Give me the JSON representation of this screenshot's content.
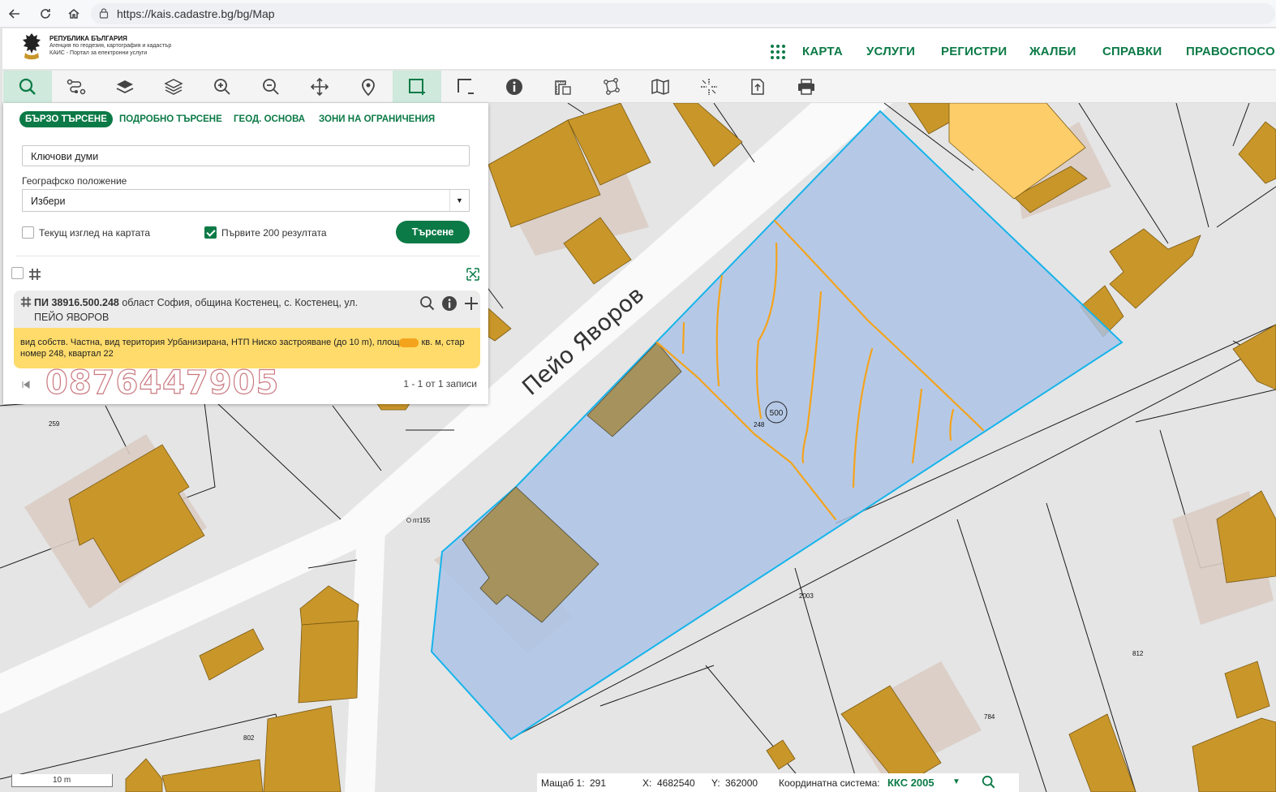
{
  "browser": {
    "url": "https://kais.cadastre.bg/bg/Map"
  },
  "header": {
    "org_line1": "РЕПУБЛИКА БЪЛГАРИЯ",
    "org_line2": "Агенция по геодезия, картография и кадастър",
    "org_line3": "КАИС - Портал за електронни услуги",
    "nav": [
      "КАРТА",
      "УСЛУГИ",
      "РЕГИСТРИ",
      "ЖАЛБИ",
      "СПРАВКИ",
      "ПРАВОСПОСО"
    ]
  },
  "toolbar": {
    "tools": [
      "search-icon",
      "route-icon",
      "layers-icon",
      "layers-stack-icon",
      "zoom-in-icon",
      "zoom-out-icon",
      "pan-icon",
      "location-pin-icon",
      "select-area-icon",
      "deselect-area-icon",
      "info-icon",
      "measure-icon",
      "vertex-icon",
      "map-icon",
      "crosshair-icon",
      "export-icon",
      "print-icon"
    ]
  },
  "panel": {
    "tabs": [
      "БЪРЗО ТЪРСЕНЕ",
      "ПОДРОБНО ТЪРСЕНЕ",
      "ГЕОД. ОСНОВА",
      "ЗОНИ НА ОГРАНИЧЕНИЯ"
    ],
    "keywords_value": "Ключови думи",
    "geo_label": "Географско положение",
    "geo_value": "Избери",
    "current_view_label": "Текущ изглед на картата",
    "first200_label": "Първите 200 резултата",
    "search_button": "Търсене",
    "result": {
      "pi_label": "ПИ 38916.500.248",
      "address": " област София, община Костенец, с. Костенец, ул.",
      "street": "ПЕЙО ЯВОРОВ",
      "description": "вид собств. Частна, вид територия Урбанизирана, НТП Ниско застрояване (до 10 m), площ",
      "description_tail": " кв. м, стар",
      "description_line2": "номер 248, квартал 22"
    },
    "pager_info": "1 - 1 от 1 записи",
    "phone_watermark": "0876447905"
  },
  "map": {
    "street_name": "Пейо Яворов",
    "labels": {
      "plot_number": "248",
      "plot_circle": "500",
      "pt": "пт155",
      "n2003": "2003",
      "n812": "812",
      "n784": "784",
      "n802": "802",
      "n259": "259"
    }
  },
  "status": {
    "scale_bar": "10 m",
    "scale_label": "Мащаб 1:",
    "scale_value": "291",
    "x_label": "X:",
    "x_value": "4682540",
    "y_label": "Y:",
    "y_value": "362000",
    "crs_label": "Координатна система:",
    "crs_value": "ККС 2005"
  },
  "colors": {
    "brand_green": "#0b7a46",
    "building": "#c9962a",
    "plot_fill": "#a9c2e6",
    "plot_border": "#16b4ea",
    "annotation_orange": "#f4a31c",
    "result_yellow": "#fedb6b"
  }
}
